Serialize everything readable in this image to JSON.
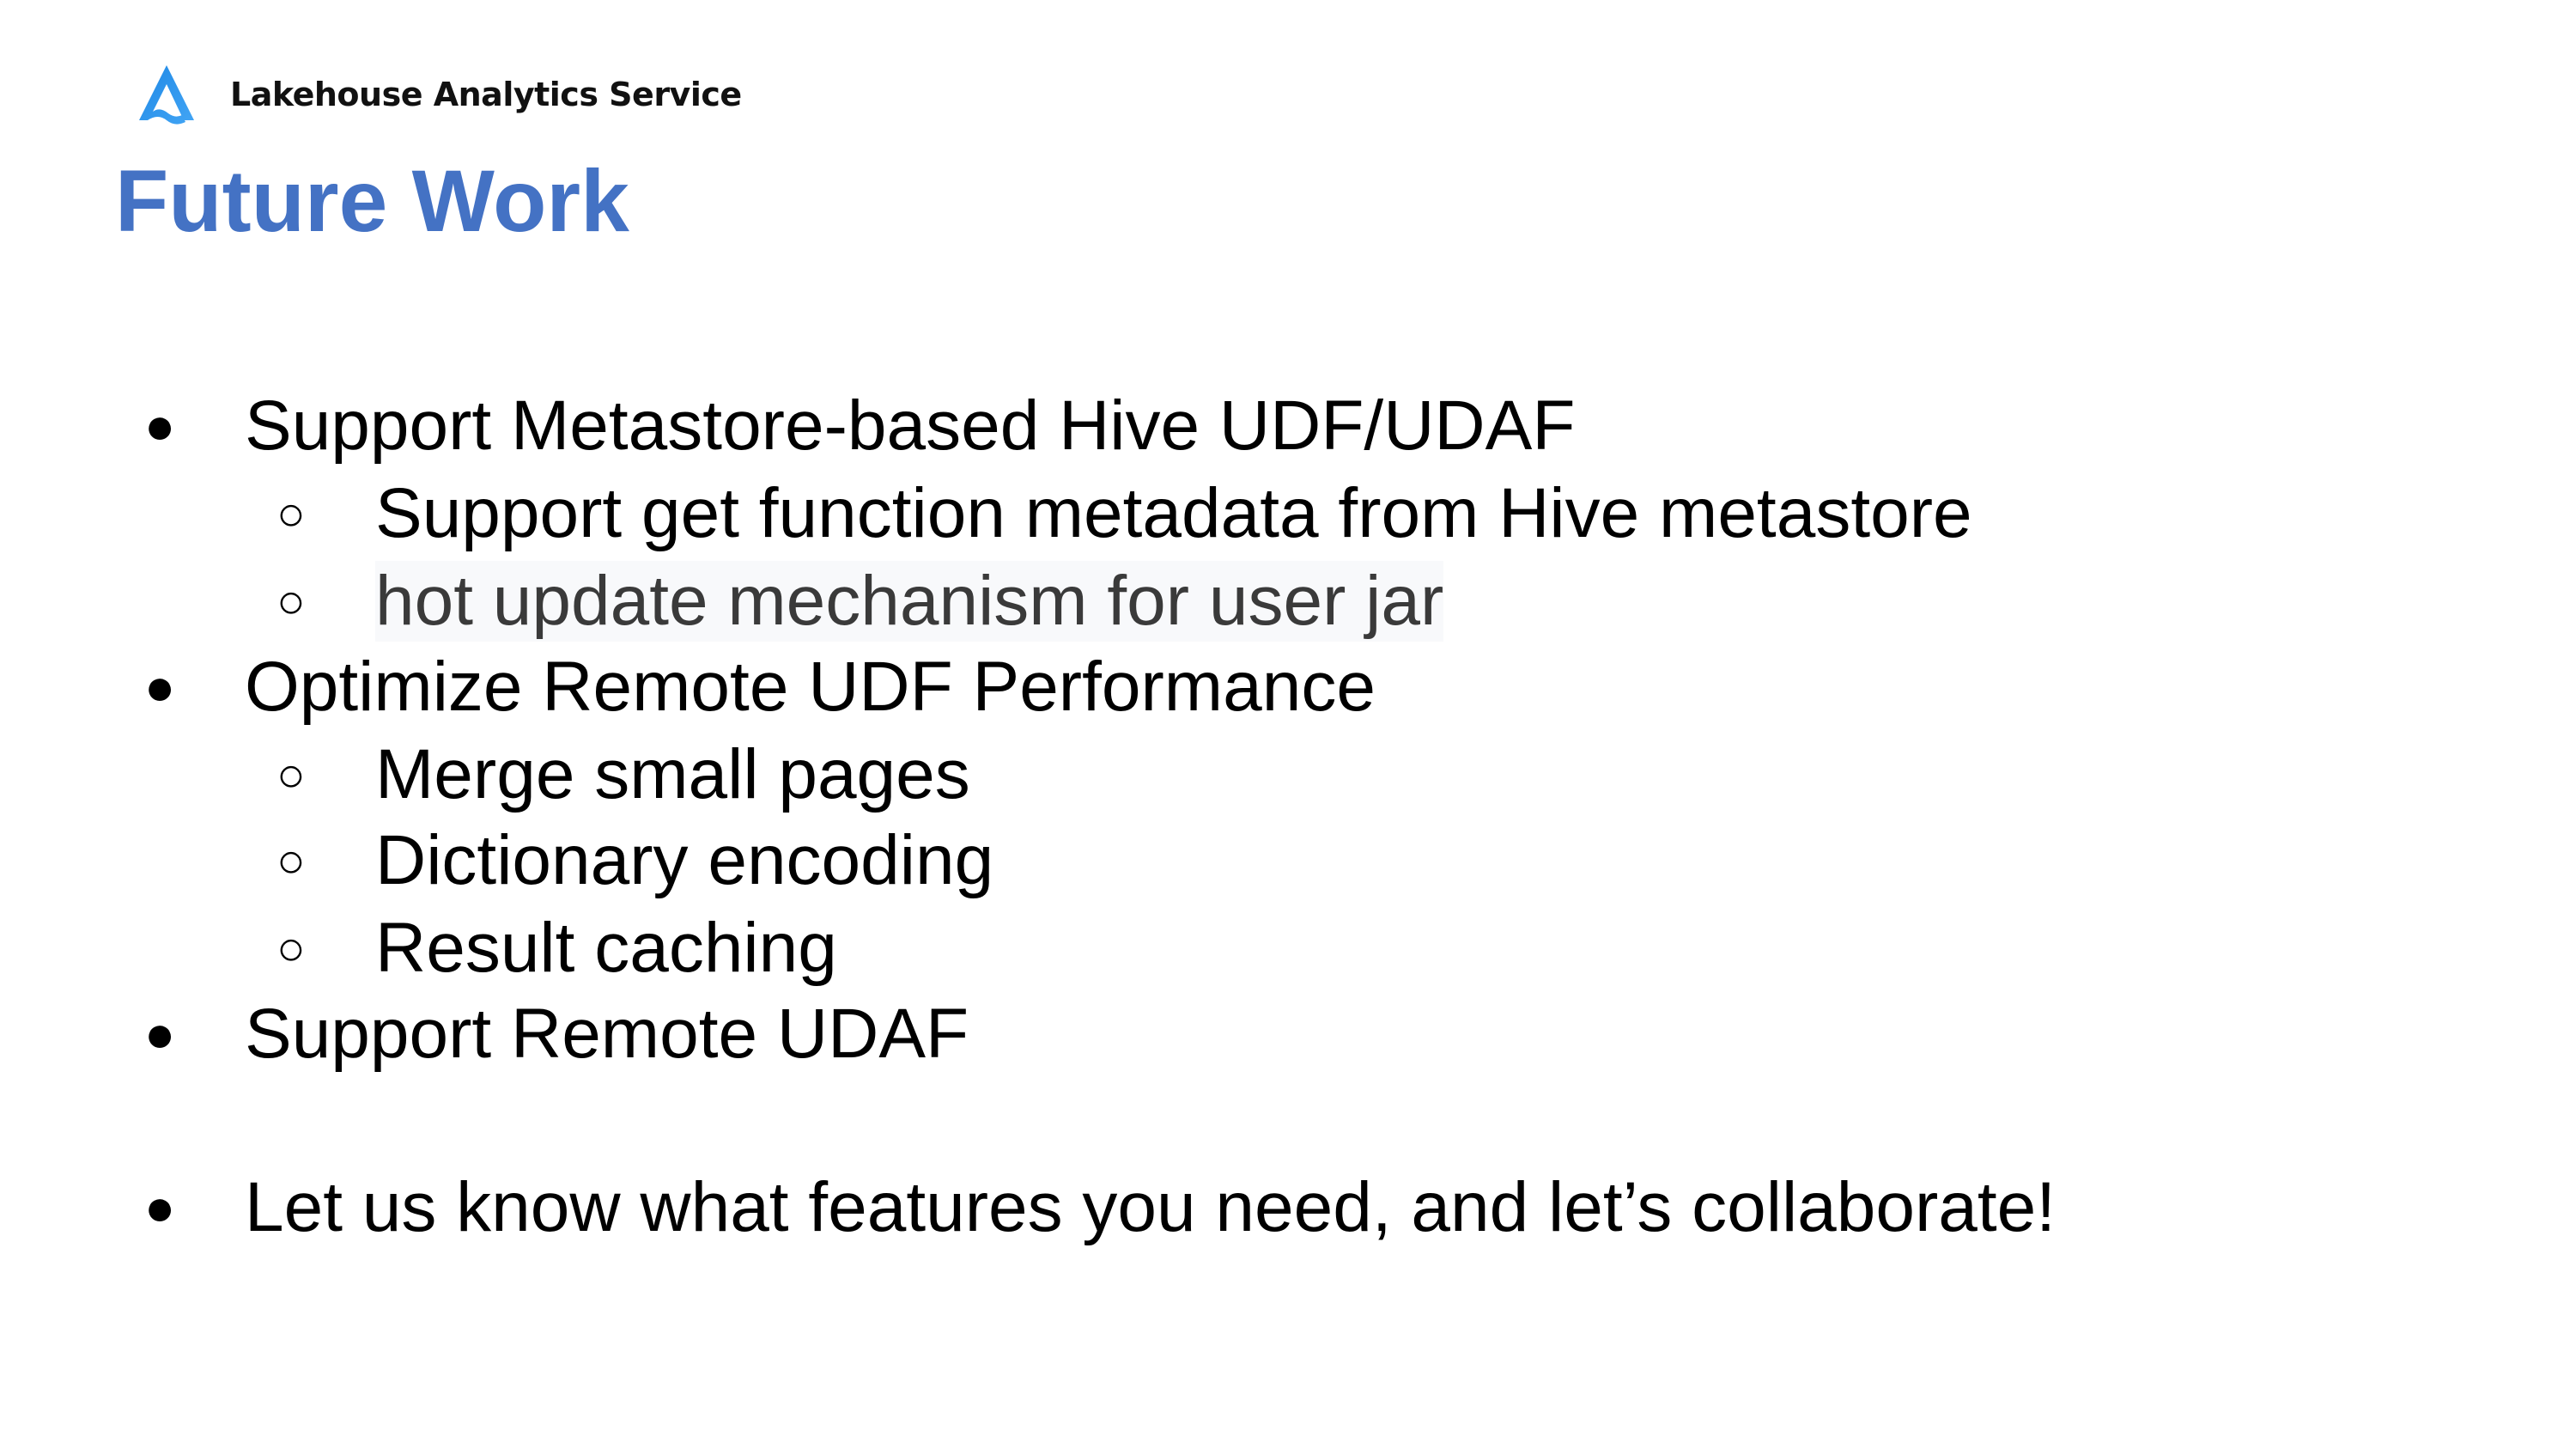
{
  "header": {
    "brand_name": "Lakehouse Analytics Service",
    "logo_icon": "triangle-wave-logo-icon",
    "brand_color": "#1e88e5"
  },
  "slide": {
    "title": "Future Work",
    "title_color": "#4472c4"
  },
  "bullets": [
    {
      "level": 1,
      "marker": "●",
      "text": "Support Metastore-based Hive UDF/UDAF"
    },
    {
      "level": 2,
      "marker": "○",
      "text": "Support get function metadata from Hive metastore"
    },
    {
      "level": 2,
      "marker": "○",
      "text": "hot update mechanism for user jar"
    },
    {
      "level": 1,
      "marker": "●",
      "text": "Optimize Remote UDF Performance"
    },
    {
      "level": 2,
      "marker": "○",
      "text": "Merge small pages"
    },
    {
      "level": 2,
      "marker": "○",
      "text": "Dictionary encoding"
    },
    {
      "level": 2,
      "marker": "○",
      "text": "Result caching"
    },
    {
      "level": 1,
      "marker": "●",
      "text": "Support Remote UDAF"
    },
    {
      "level": 1,
      "marker": "●",
      "text": "Let us know what features you need, and let’s collaborate!"
    }
  ]
}
